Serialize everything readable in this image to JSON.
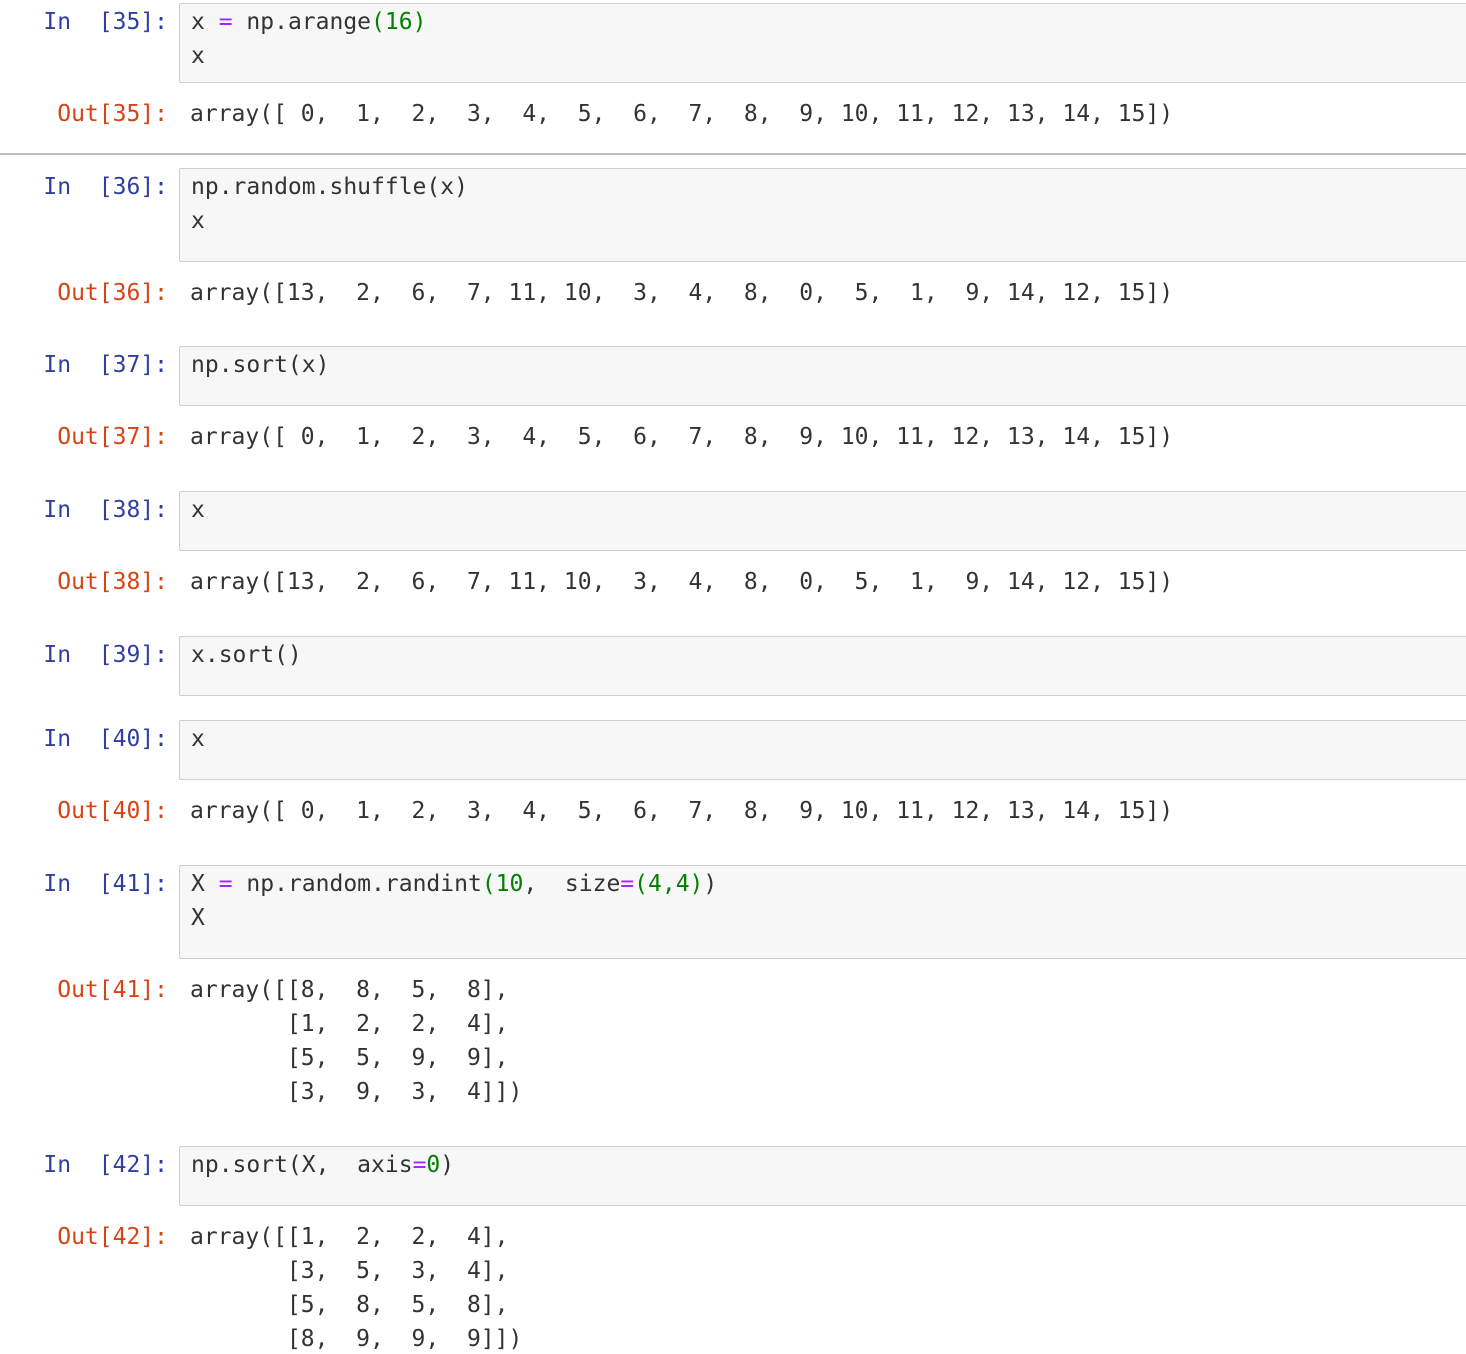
{
  "cells": [
    {
      "in_prompt": "In  [35]:",
      "code_lines": [
        [
          {
            "t": "x "
          },
          {
            "t": "=",
            "c": "op"
          },
          {
            "t": " np.arange"
          },
          {
            "t": "(16)",
            "c": "num"
          }
        ],
        [
          {
            "t": "x"
          }
        ]
      ],
      "out_prompt": "Out[35]:",
      "output": "array([ 0,  1,  2,  3,  4,  5,  6,  7,  8,  9, 10, 11, 12, 13, 14, 15])"
    },
    {
      "in_prompt": "In  [36]:",
      "code_lines": [
        [
          {
            "t": "np.random.shuffle(x)"
          }
        ],
        [
          {
            "t": "x"
          }
        ]
      ],
      "out_prompt": "Out[36]:",
      "output": "array([13,  2,  6,  7, 11, 10,  3,  4,  8,  0,  5,  1,  9, 14, 12, 15])"
    },
    {
      "in_prompt": "In  [37]:",
      "code_lines": [
        [
          {
            "t": "np.sort(x)"
          }
        ]
      ],
      "out_prompt": "Out[37]:",
      "output": "array([ 0,  1,  2,  3,  4,  5,  6,  7,  8,  9, 10, 11, 12, 13, 14, 15])"
    },
    {
      "in_prompt": "In  [38]:",
      "code_lines": [
        [
          {
            "t": "x"
          }
        ]
      ],
      "out_prompt": "Out[38]:",
      "output": "array([13,  2,  6,  7, 11, 10,  3,  4,  8,  0,  5,  1,  9, 14, 12, 15])"
    },
    {
      "in_prompt": "In  [39]:",
      "code_lines": [
        [
          {
            "t": "x.sort()"
          }
        ]
      ],
      "out_prompt": "",
      "output": ""
    },
    {
      "in_prompt": "In  [40]:",
      "code_lines": [
        [
          {
            "t": "x"
          }
        ]
      ],
      "out_prompt": "Out[40]:",
      "output": "array([ 0,  1,  2,  3,  4,  5,  6,  7,  8,  9, 10, 11, 12, 13, 14, 15])"
    },
    {
      "in_prompt": "In  [41]:",
      "code_lines": [
        [
          {
            "t": "X "
          },
          {
            "t": "=",
            "c": "op"
          },
          {
            "t": " np.random.randint"
          },
          {
            "t": "(10",
            "c": "num"
          },
          {
            "t": ",  size"
          },
          {
            "t": "=",
            "c": "op"
          },
          {
            "t": "(4,4)",
            "c": "num"
          },
          {
            "t": ")"
          }
        ],
        [
          {
            "t": "X"
          }
        ]
      ],
      "out_prompt": "Out[41]:",
      "output": "array([[8,  8,  5,  8],\n       [1,  2,  2,  4],\n       [5,  5,  9,  9],\n       [3,  9,  3,  4]])"
    },
    {
      "in_prompt": "In  [42]:",
      "code_lines": [
        [
          {
            "t": "np.sort(X,  axis"
          },
          {
            "t": "=",
            "c": "op"
          },
          {
            "t": "0",
            "c": "num"
          },
          {
            "t": ")"
          }
        ]
      ],
      "out_prompt": "Out[42]:",
      "output": "array([[1,  2,  2,  4],\n       [3,  5,  3,  4],\n       [5,  8,  5,  8],\n       [8,  9,  9,  9]])"
    }
  ]
}
